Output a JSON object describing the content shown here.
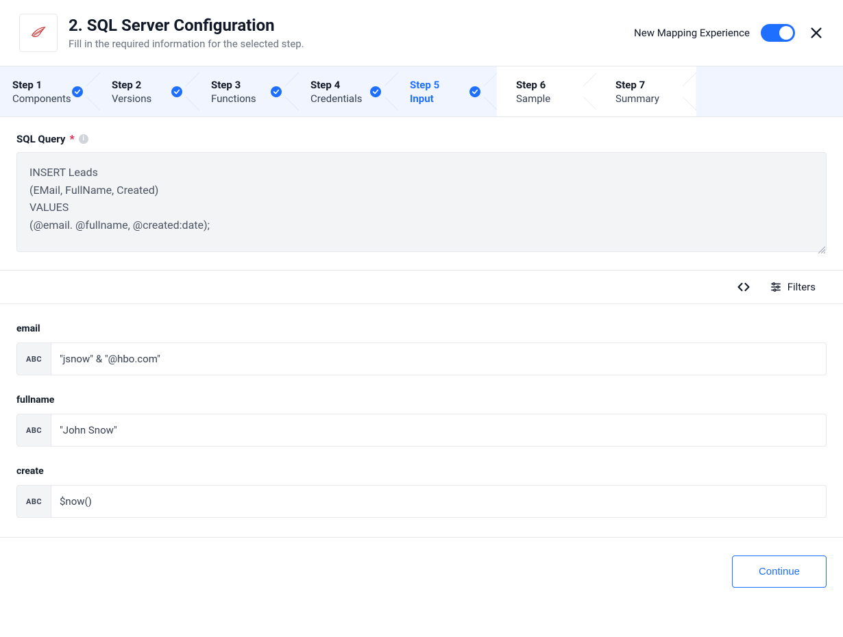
{
  "header": {
    "title": "2. SQL Server Configuration",
    "subtitle": "Fill in the required information for the selected step.",
    "mapping_label": "New Mapping Experience"
  },
  "steps": [
    {
      "label": "Step 1",
      "sub": "Components",
      "done": true,
      "active": false,
      "white": false
    },
    {
      "label": "Step 2",
      "sub": "Versions",
      "done": true,
      "active": false,
      "white": false
    },
    {
      "label": "Step 3",
      "sub": "Functions",
      "done": true,
      "active": false,
      "white": false
    },
    {
      "label": "Step 4",
      "sub": "Credentials",
      "done": true,
      "active": false,
      "white": false
    },
    {
      "label": "Step 5",
      "sub": "Input",
      "done": true,
      "active": true,
      "white": false
    },
    {
      "label": "Step 6",
      "sub": "Sample",
      "done": false,
      "active": false,
      "white": true
    },
    {
      "label": "Step 7",
      "sub": "Summary",
      "done": false,
      "active": false,
      "white": true
    }
  ],
  "sql": {
    "label": "SQL Query",
    "value": "INSERT Leads\n(EMail, FullName, Created)\nVALUES\n(@email. @fullname, @created:date);"
  },
  "toolbar": {
    "filters_label": "Filters"
  },
  "params": [
    {
      "label": "email",
      "badge": "ABC",
      "value": "\"jsnow\" & \"@hbo.com\""
    },
    {
      "label": "fullname",
      "badge": "ABC",
      "value": "\"John Snow\""
    },
    {
      "label": "create",
      "badge": "ABC",
      "value": "$now()"
    }
  ],
  "footer": {
    "continue_label": "Continue"
  }
}
